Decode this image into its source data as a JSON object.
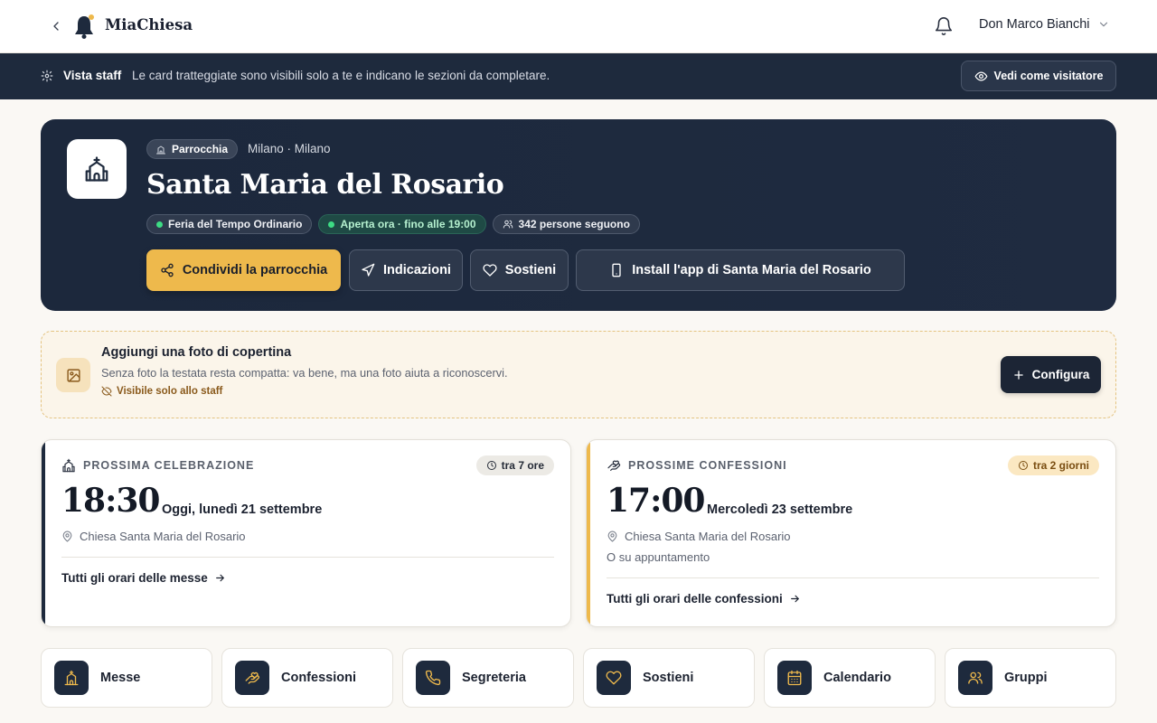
{
  "app": {
    "name": "MiaChiesa"
  },
  "user": {
    "name": "Don Marco Bianchi"
  },
  "staff_banner": {
    "label": "Vista staff",
    "text": "Le card tratteggiate sono visibili solo a te e indicano le sezioni da completare.",
    "visitor_button": "Vedi come visitatore"
  },
  "hero": {
    "type": "Parrocchia",
    "location": "Milano · Milano",
    "name": "Santa Maria del Rosario",
    "badges": {
      "liturgy": "Feria del Tempo Ordinario",
      "open": "Aperta ora · fino alle 19:00",
      "followers": "342 persone seguono"
    },
    "buttons": {
      "share": "Condividi la parrocchia",
      "directions": "Indicazioni",
      "support": "Sostieni",
      "install": "Install l'app di Santa Maria del Rosario"
    }
  },
  "todo": {
    "title": "Aggiungi una foto di copertina",
    "description": "Senza foto la testata resta compatta: va bene, ma una foto aiuta a riconoscervi.",
    "staff_note": "Visibile solo allo staff",
    "button": "Configura"
  },
  "next_mass": {
    "heading": "PROSSIMA CELEBRAZIONE",
    "relative": "tra 7 ore",
    "time": "18:30",
    "day": "Oggi, lunedì 21 settembre",
    "place": "Chiesa Santa Maria del Rosario",
    "link": "Tutti gli orari delle messe"
  },
  "next_confession": {
    "heading": "PROSSIME CONFESSIONI",
    "relative": "tra 2 giorni",
    "time": "17:00",
    "day": "Mercoledì 23 settembre",
    "place": "Chiesa Santa Maria del Rosario",
    "note": "O su appuntamento",
    "link": "Tutti gli orari delle confessioni"
  },
  "tiles": [
    {
      "label": "Messe",
      "icon": "church-icon"
    },
    {
      "label": "Confessioni",
      "icon": "hand-heart-icon"
    },
    {
      "label": "Segreteria",
      "icon": "phone-icon"
    },
    {
      "label": "Sostieni",
      "icon": "heart-icon"
    },
    {
      "label": "Calendario",
      "icon": "calendar-icon"
    },
    {
      "label": "Gruppi",
      "icon": "users-icon"
    }
  ],
  "colors": {
    "navy": "#1e2a3d",
    "accent": "#eeb94c",
    "open_green": "#3ddc84",
    "page_bg": "#faf8f4"
  }
}
